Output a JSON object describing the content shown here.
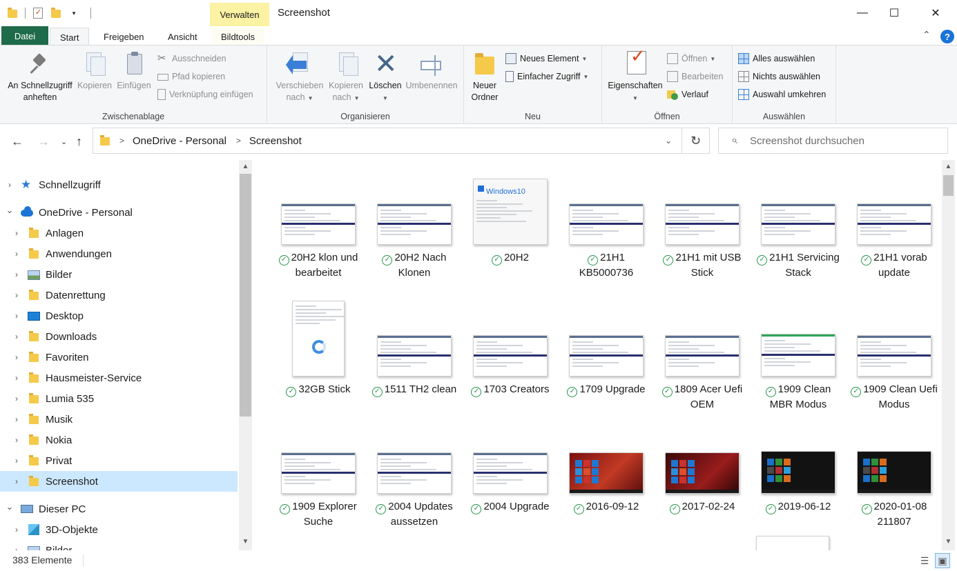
{
  "window": {
    "title": "Screenshot",
    "context_tab": "Verwalten",
    "minimize_glyph": "—",
    "maximize_glyph": "☐",
    "close_glyph": "✕"
  },
  "ribbon_tabs": {
    "file": "Datei",
    "start": "Start",
    "share": "Freigeben",
    "view": "Ansicht",
    "picture_tools": "Bildtools",
    "collapse_glyph": "⌃",
    "help_glyph": "?"
  },
  "clipboard": {
    "label": "Zwischenablage",
    "pin_line1": "An Schnellzugriff",
    "pin_line2": "anheften",
    "copy": "Kopieren",
    "paste": "Einfügen",
    "cut": "Ausschneiden",
    "copy_path": "Pfad kopieren",
    "paste_shortcut": "Verknüpfung einfügen"
  },
  "organize": {
    "label": "Organisieren",
    "move_line1": "Verschieben",
    "move_line2": "nach",
    "copyto_line1": "Kopieren",
    "copyto_line2": "nach",
    "delete": "Löschen",
    "rename": "Umbenennen"
  },
  "new": {
    "label": "Neu",
    "folder_line1": "Neuer",
    "folder_line2": "Ordner",
    "new_item": "Neues Element",
    "easy_access": "Einfacher Zugriff"
  },
  "open": {
    "label": "Öffnen",
    "properties": "Eigenschaften",
    "open": "Öffnen",
    "edit": "Bearbeiten",
    "history": "Verlauf"
  },
  "select": {
    "label": "Auswählen",
    "select_all": "Alles auswählen",
    "select_none": "Nichts auswählen",
    "invert": "Auswahl umkehren"
  },
  "address": {
    "crumbs": [
      "OneDrive - Personal",
      "Screenshot"
    ],
    "search_placeholder": "Screenshot durchsuchen"
  },
  "nav": {
    "items": [
      {
        "label": "Schnellzugriff",
        "icon": "star-icon",
        "level": 0,
        "expanded": false
      },
      {
        "label": "OneDrive - Personal",
        "icon": "cloud-icon",
        "level": 0,
        "expanded": true
      },
      {
        "label": "Anlagen",
        "icon": "folder-icon",
        "level": 1
      },
      {
        "label": "Anwendungen",
        "icon": "folder-icon",
        "level": 1
      },
      {
        "label": "Bilder",
        "icon": "pictures-icon",
        "level": 1
      },
      {
        "label": "Datenrettung",
        "icon": "folder-icon",
        "level": 1
      },
      {
        "label": "Desktop",
        "icon": "desktop-icon",
        "level": 1
      },
      {
        "label": "Downloads",
        "icon": "folder-icon",
        "level": 1
      },
      {
        "label": "Favoriten",
        "icon": "folder-icon",
        "level": 1
      },
      {
        "label": "Hausmeister-Service",
        "icon": "folder-icon",
        "level": 1
      },
      {
        "label": "Lumia 535",
        "icon": "folder-icon",
        "level": 1
      },
      {
        "label": "Musik",
        "icon": "folder-icon",
        "level": 1
      },
      {
        "label": "Nokia",
        "icon": "folder-icon",
        "level": 1
      },
      {
        "label": "Privat",
        "icon": "folder-icon",
        "level": 1
      },
      {
        "label": "Screenshot",
        "icon": "folder-icon",
        "level": 1,
        "selected": true
      },
      {
        "label": "Dieser PC",
        "icon": "pc-icon",
        "level": 0,
        "expanded": true
      },
      {
        "label": "3D-Objekte",
        "icon": "cube-icon",
        "level": 1
      },
      {
        "label": "Bilder",
        "icon": "pictures-icon",
        "level": 1
      }
    ]
  },
  "files": [
    {
      "name": "20H2 klon und bearbeitet",
      "style": "light"
    },
    {
      "name": "20H2 Nach Klonen",
      "style": "light"
    },
    {
      "name": "20H2",
      "style": "about"
    },
    {
      "name": "21H1 KB5000736",
      "style": "light"
    },
    {
      "name": "21H1 mit USB Stick",
      "style": "light"
    },
    {
      "name": "21H1 Servicing Stack",
      "style": "light"
    },
    {
      "name": "21H1 vorab update",
      "style": "light"
    },
    {
      "name": "32GB Stick",
      "style": "props"
    },
    {
      "name": "1511 TH2 clean",
      "style": "light"
    },
    {
      "name": "1703 Creators",
      "style": "light"
    },
    {
      "name": "1709 Upgrade",
      "style": "light"
    },
    {
      "name": "1809 Acer Uefi OEM",
      "style": "light"
    },
    {
      "name": "1909 Clean MBR Modus",
      "style": "green"
    },
    {
      "name": "1909 Clean Uefi Modus",
      "style": "light"
    },
    {
      "name": "1909 Explorer Suche",
      "style": "light"
    },
    {
      "name": "2004 Updates aussetzen",
      "style": "light"
    },
    {
      "name": "2004 Upgrade",
      "style": "light"
    },
    {
      "name": "2016-09-12",
      "style": "win"
    },
    {
      "name": "2017-02-24",
      "style": "win2"
    },
    {
      "name": "2019-06-12",
      "style": "dark"
    },
    {
      "name": "2020-01-08 211807",
      "style": "dark"
    }
  ],
  "about_thumb_text": "Windows10",
  "sync_glyph": "✓",
  "status": {
    "count": "383 Elemente"
  }
}
